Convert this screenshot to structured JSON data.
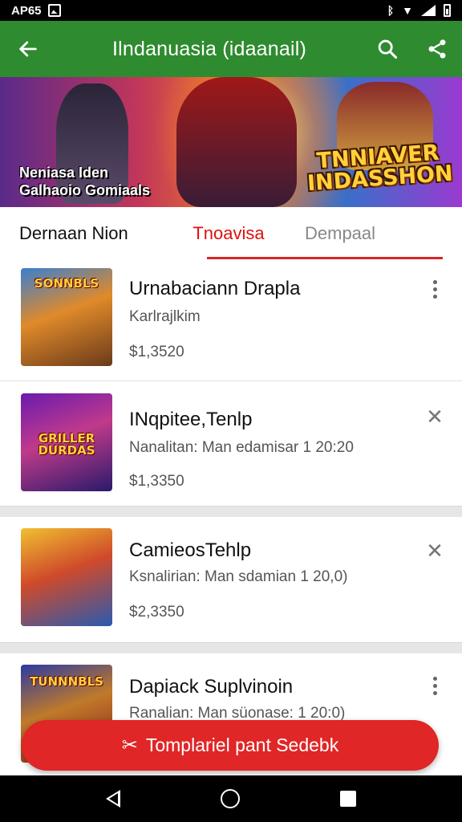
{
  "status_bar": {
    "time": "AP65",
    "icons": [
      "image-icon",
      "bluetooth-icon",
      "wifi-icon",
      "signal-icon",
      "battery-icon"
    ]
  },
  "app_bar": {
    "title": "Ilndanuasia (idaanail)",
    "back_icon": "arrow-left-icon",
    "search_icon": "search-icon",
    "share_icon": "share-icon",
    "color": "#2e8b2f"
  },
  "banner": {
    "left_text_line1": "Neniasa Iden",
    "left_text_line2": "Galhaoio Gomiaals",
    "logo_line1": "TNNIAVER",
    "logo_line2": "INDASSHON"
  },
  "tabs": [
    {
      "label": "Dernaan  Nion",
      "active": false
    },
    {
      "label": "Tnoavisa",
      "active": true
    },
    {
      "label": "Dempaal",
      "active": false
    }
  ],
  "items": [
    {
      "title": "Urnabaciann Drapla",
      "subtitle": "Karlrajlkim",
      "price": "$1,3520",
      "action": "more-vert-icon",
      "thumb_label": "SONNBLS"
    },
    {
      "title": "INqpitee,Tenlp",
      "subtitle": "Nanalitan: Man edamisar 1 20:20",
      "price": "$1,3350",
      "action": "close-icon",
      "thumb_label": "GRILLER DURDAS"
    },
    {
      "title": "CamieosTehlp",
      "subtitle": "Ksnalirian: Man sdamian 1 20,0)",
      "price": "$2,3350",
      "action": "close-icon",
      "thumb_label": ""
    },
    {
      "title": "Dapiack Suplvinoin",
      "subtitle": "Ranalian: Man süonase: 1 20:0)",
      "price": "",
      "action": "more-vert-icon",
      "thumb_label": "TUNNNBLS"
    }
  ],
  "cta": {
    "label": "Tomplariel pant Sedebk",
    "icon": "tool-icon",
    "color": "#e02626"
  },
  "nav": {
    "back": "nav-back-icon",
    "home": "nav-home-icon",
    "recent": "nav-recent-icon"
  }
}
